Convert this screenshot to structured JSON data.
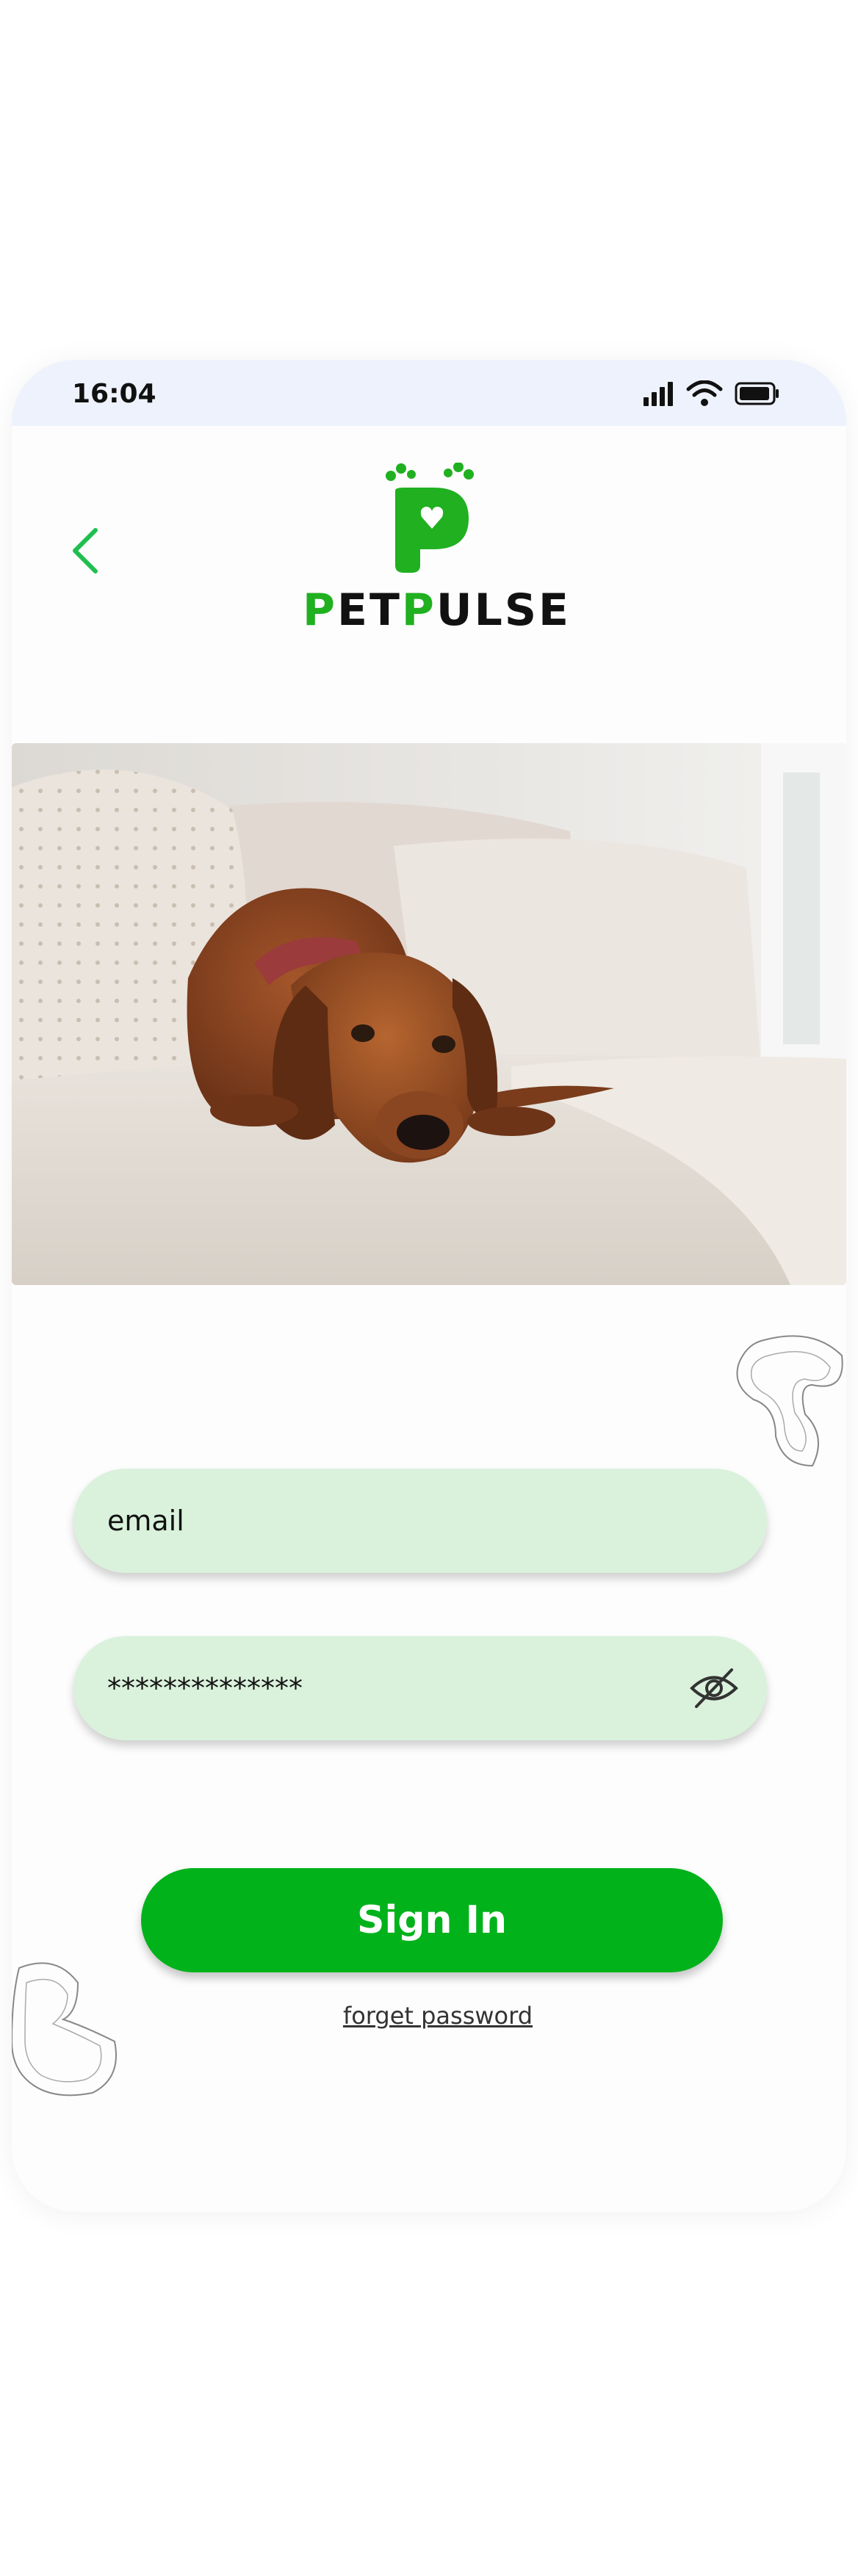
{
  "status_bar": {
    "time": "16:04"
  },
  "brand": {
    "logo_letter": "P",
    "name_parts": [
      "P",
      "ET",
      "P",
      "ULSE"
    ],
    "accent_color": "#20b020"
  },
  "icons": {
    "back": "chevron-left-icon",
    "signal": "cellular-signal-icon",
    "wifi": "wifi-icon",
    "battery": "battery-icon",
    "eye": "eye-off-icon"
  },
  "login_form": {
    "email_placeholder": "email",
    "password_value": "**************",
    "signin_label": "Sign In",
    "forget_password_label": "forget password"
  },
  "colors": {
    "primary_button": "#02b21b",
    "field_background": "#daf2dc",
    "back_arrow": "#1fbf4f"
  }
}
